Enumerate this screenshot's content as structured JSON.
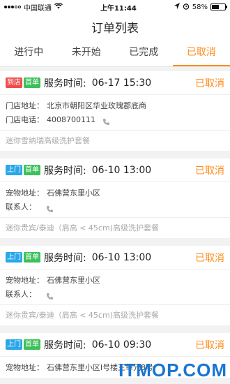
{
  "status_bar": {
    "carrier": "中国联通",
    "time": "上午11:44",
    "battery": "58%",
    "battery_level": 0.58
  },
  "header": {
    "title": "订单列表"
  },
  "tabs": [
    {
      "label": "进行中"
    },
    {
      "label": "未开始"
    },
    {
      "label": "已完成"
    },
    {
      "label": "已取消"
    }
  ],
  "orders": [
    {
      "badge_type": "到店",
      "badge_type_color": "#f04c4c",
      "badge_first": "首单",
      "service_label": "服务时间:",
      "service_time": "06-17 15:30",
      "status": "已取消",
      "row1_label": "门店地址：",
      "row1_value": "北京市朝阳区华业玫瑰郡底商",
      "row2_label": "门店电话：",
      "row2_value": "4008700111",
      "package": "迷你雪纳瑞高级洗护套餐"
    },
    {
      "badge_type": "上门",
      "badge_type_color": "#2aa7e8",
      "badge_first": "首单",
      "service_label": "服务时间:",
      "service_time": "06-10 13:00",
      "status": "已取消",
      "row1_label": "宠物地址：",
      "row1_value": "石佛营东里小区",
      "row2_label": "联系人：",
      "row2_value": "",
      "package": "迷你贵宾/泰迪（肩高 < 45cm)高级洗护套餐"
    },
    {
      "badge_type": "上门",
      "badge_type_color": "#2aa7e8",
      "badge_first": "首单",
      "service_label": "服务时间:",
      "service_time": "06-10 13:00",
      "status": "已取消",
      "row1_label": "宠物地址：",
      "row1_value": "石佛营东里小区",
      "row2_label": "联系人：",
      "row2_value": "",
      "package": "迷你贵宾/泰迪（肩高 < 45cm)高级洗护套餐"
    },
    {
      "badge_type": "上门",
      "badge_type_color": "#2aa7e8",
      "badge_first": "首单",
      "service_label": "服务时间:",
      "service_time": "06-10 09:30",
      "status": "已取消",
      "row1_label": "宠物地址：",
      "row1_value": "石佛营东里小区l号楼三单元8号"
    }
  ],
  "watermark": "ITMOP.COM",
  "accent_color": "#ff8c1a"
}
